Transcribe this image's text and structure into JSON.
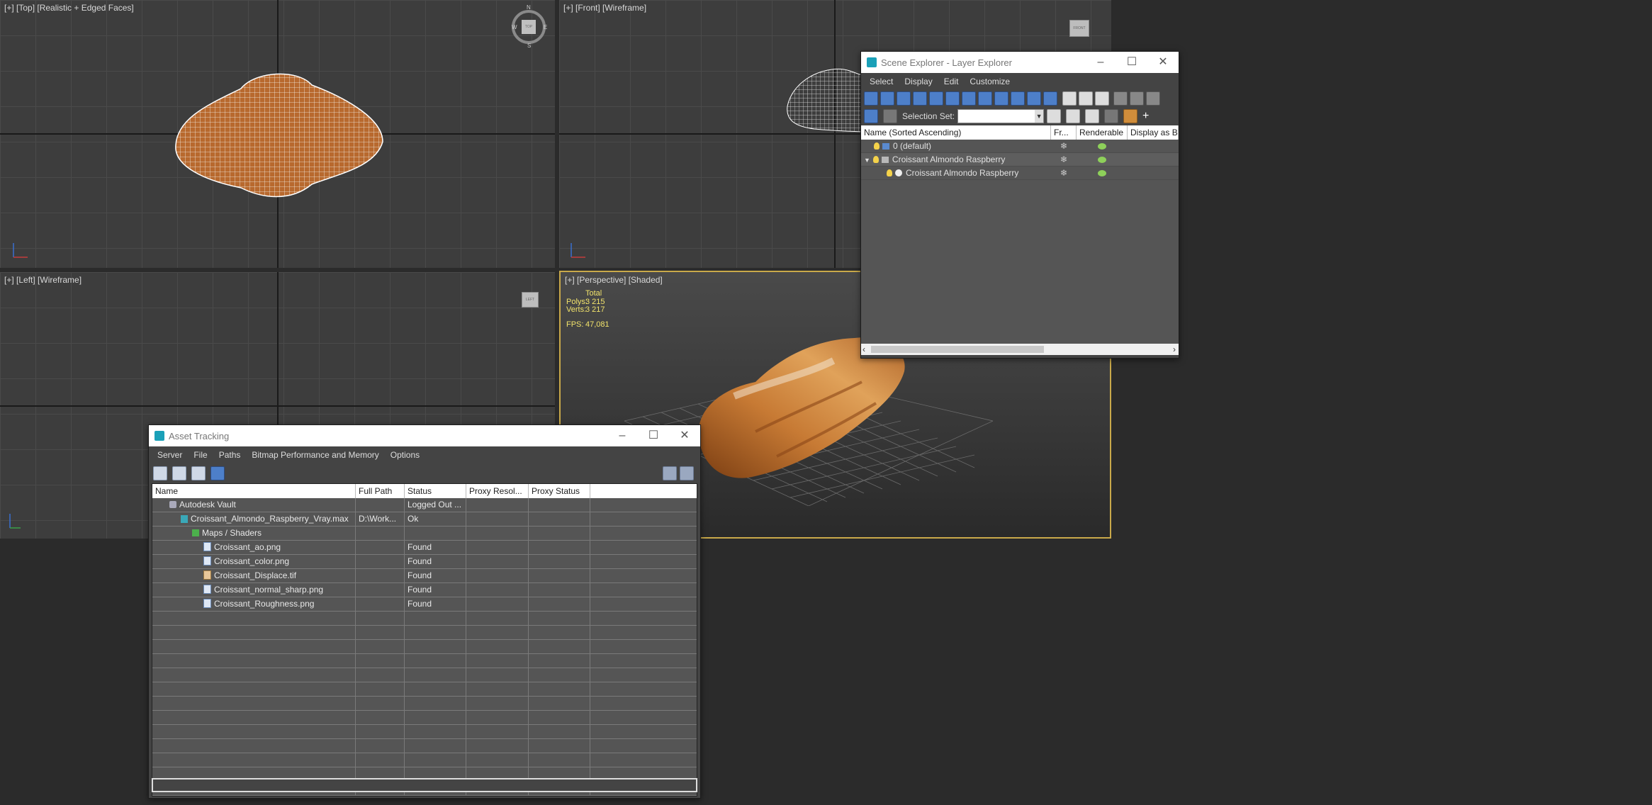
{
  "viewports": {
    "top": {
      "label": "[+] [Top] [Realistic + Edged Faces]"
    },
    "front": {
      "label": "[+] [Front] [Wireframe]"
    },
    "left": {
      "label": "[+] [Left] [Wireframe]"
    },
    "perspective": {
      "label": "[+] [Perspective] [Shaded]"
    }
  },
  "viewcube": {
    "top_face": "TOP",
    "front_face": "FRONT",
    "left_face": "LEFT",
    "compass": {
      "n": "N",
      "s": "S",
      "e": "E",
      "w": "W"
    }
  },
  "stats": {
    "total_label": "Total",
    "polys_label": "Polys:",
    "polys_value": "3 215",
    "verts_label": "Verts:",
    "verts_value": "3 217",
    "fps_label": "FPS:",
    "fps_value": "47,081"
  },
  "scene_explorer": {
    "title": "Scene Explorer - Layer Explorer",
    "menu": [
      "Select",
      "Display",
      "Edit",
      "Customize"
    ],
    "selection_set_label": "Selection Set:",
    "columns": [
      "Name (Sorted Ascending)",
      "Fr...",
      "Renderable",
      "Display as Box"
    ],
    "rows": [
      {
        "name": "0 (default)"
      },
      {
        "name": "Croissant Almondo Raspberry"
      },
      {
        "name": "Croissant Almondo Raspberry"
      }
    ]
  },
  "asset_tracking": {
    "title": "Asset Tracking",
    "menu": [
      "Server",
      "File",
      "Paths",
      "Bitmap Performance and Memory",
      "Options"
    ],
    "columns": [
      "Name",
      "Full Path",
      "Status",
      "Proxy Resol...",
      "Proxy Status"
    ],
    "rows": [
      {
        "name": "Autodesk Vault",
        "path": "",
        "status": "Logged Out ..."
      },
      {
        "name": "Croissant_Almondo_Raspberry_Vray.max",
        "path": "D:\\Work...",
        "status": "Ok"
      },
      {
        "name": "Maps / Shaders",
        "path": "",
        "status": ""
      },
      {
        "name": "Croissant_ao.png",
        "path": "",
        "status": "Found"
      },
      {
        "name": "Croissant_color.png",
        "path": "",
        "status": "Found"
      },
      {
        "name": "Croissant_Displace.tif",
        "path": "",
        "status": "Found"
      },
      {
        "name": "Croissant_normal_sharp.png",
        "path": "",
        "status": "Found"
      },
      {
        "name": "Croissant_Roughness.png",
        "path": "",
        "status": "Found"
      }
    ]
  },
  "colors": {
    "active_viewport_border": "#c9a94a",
    "wire": "#ffffff",
    "croissant": "#c07a3a"
  }
}
